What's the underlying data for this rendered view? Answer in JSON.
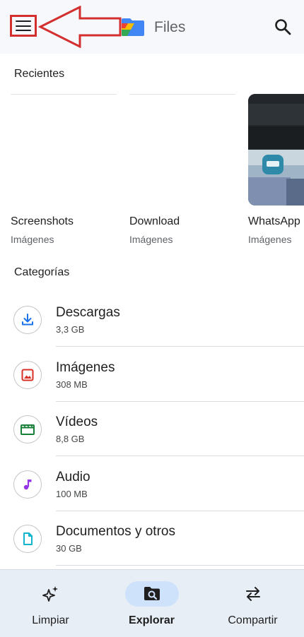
{
  "appbar": {
    "title": "Files",
    "menu_icon": "hamburger-menu-icon",
    "search_icon": "search-icon",
    "annotation_color": "#d32f2f"
  },
  "recents": {
    "heading": "Recientes",
    "items": [
      {
        "name": "Screenshots",
        "kind": "Imágenes"
      },
      {
        "name": "Download",
        "kind": "Imágenes"
      },
      {
        "name": "WhatsApp",
        "kind": "Imágenes"
      }
    ]
  },
  "categories": {
    "heading": "Categorías",
    "items": [
      {
        "label": "Descargas",
        "size": "3,3 GB",
        "icon": "download-icon",
        "color": "#1a73e8"
      },
      {
        "label": "Imágenes",
        "size": "308 MB",
        "icon": "image-icon",
        "color": "#d93025"
      },
      {
        "label": "Vídeos",
        "size": "8,8 GB",
        "icon": "video-icon",
        "color": "#188038"
      },
      {
        "label": "Audio",
        "size": "100 MB",
        "icon": "music-note-icon",
        "color": "#9334e6"
      },
      {
        "label": "Documentos y otros",
        "size": "30 GB",
        "icon": "document-icon",
        "color": "#12b5cb"
      }
    ]
  },
  "bottom_nav": {
    "items": [
      {
        "label": "Limpiar",
        "icon": "sparkle-icon",
        "active": false
      },
      {
        "label": "Explorar",
        "icon": "browse-folder-icon",
        "active": true
      },
      {
        "label": "Compartir",
        "icon": "swap-arrows-icon",
        "active": false
      }
    ],
    "active_color": "#cfe2fb"
  }
}
